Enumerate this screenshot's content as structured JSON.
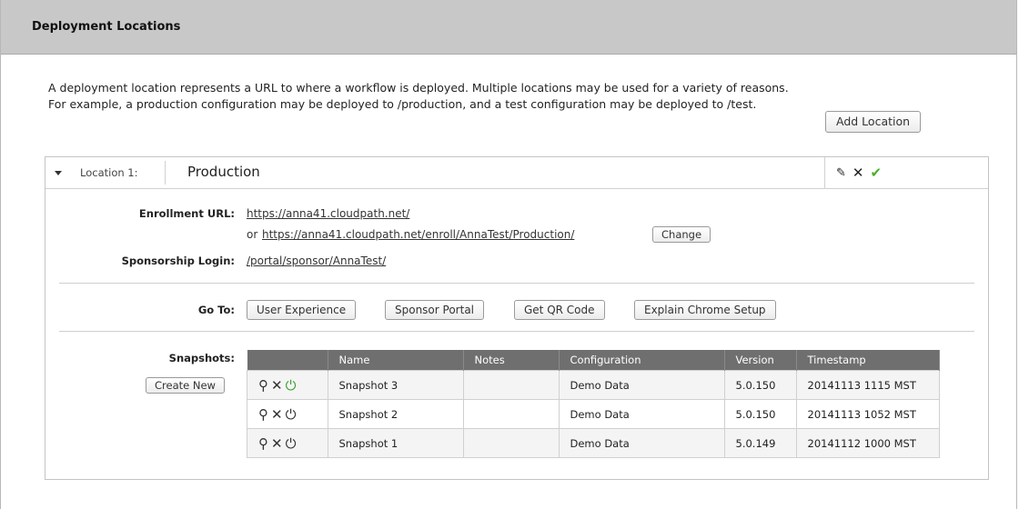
{
  "header": {
    "title": "Deployment Locations"
  },
  "description": "A deployment location represents a URL to where a workflow is deployed. Multiple locations may be used for a variety of reasons. For example, a production configuration may be deployed to /production, and a test configuration may be deployed to /test.",
  "add_location_label": "Add Location",
  "location": {
    "label": "Location 1:",
    "name": "Production",
    "icons": [
      "edit-icon",
      "delete-icon",
      "check-icon"
    ],
    "enrollment_url_label": "Enrollment URL:",
    "enrollment_url": "https://anna41.cloudpath.net/",
    "enrollment_or": "or",
    "enrollment_url_alt": "https://anna41.cloudpath.net/enroll/AnnaTest/Production/",
    "change_label": "Change",
    "sponsorship_label": "Sponsorship Login:",
    "sponsorship_url": "/portal/sponsor/AnnaTest/",
    "goto_label": "Go To:",
    "goto_buttons": [
      "User Experience",
      "Sponsor Portal",
      "Get QR Code",
      "Explain Chrome Setup"
    ],
    "snapshots_label": "Snapshots:",
    "create_new_label": "Create New",
    "snapshots": {
      "columns": [
        "",
        "Name",
        "Notes",
        "Configuration",
        "Version",
        "Timestamp"
      ],
      "rows": [
        {
          "name": "Snapshot 3",
          "notes": "",
          "configuration": "Demo Data",
          "version": "5.0.150",
          "timestamp": "20141113 1115 MST",
          "active": true
        },
        {
          "name": "Snapshot 2",
          "notes": "",
          "configuration": "Demo Data",
          "version": "5.0.150",
          "timestamp": "20141113 1052 MST",
          "active": false
        },
        {
          "name": "Snapshot 1",
          "notes": "",
          "configuration": "Demo Data",
          "version": "5.0.149",
          "timestamp": "20141112 1000 MST",
          "active": false
        }
      ]
    }
  },
  "colors": {
    "header_bg": "#c8c8c8",
    "table_header_bg": "#6f6f6f",
    "active_power": "#3aa335",
    "check": "#4caf2a"
  }
}
